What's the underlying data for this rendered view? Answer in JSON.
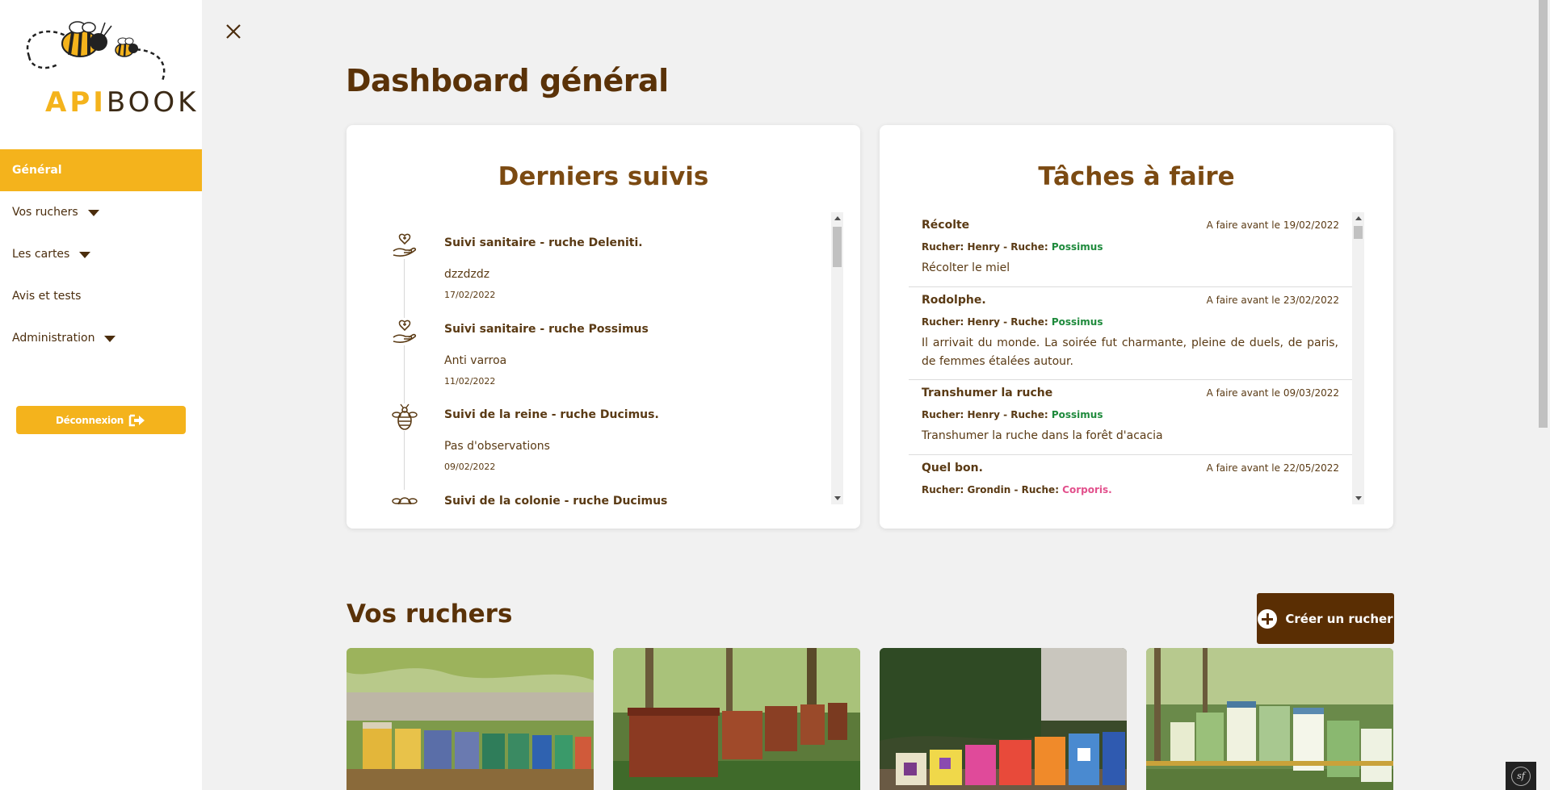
{
  "brand": {
    "api": "API",
    "book": "BOOK"
  },
  "sidebar": {
    "items": [
      {
        "label": "Général",
        "active": true,
        "has_caret": false
      },
      {
        "label": "Vos ruchers",
        "active": false,
        "has_caret": true
      },
      {
        "label": "Les cartes",
        "active": false,
        "has_caret": true
      },
      {
        "label": "Avis et tests",
        "active": false,
        "has_caret": false
      },
      {
        "label": "Administration",
        "active": false,
        "has_caret": true
      }
    ],
    "logout_label": "Déconnexion"
  },
  "page_title": "Dashboard général",
  "suivis": {
    "title": "Derniers suivis",
    "items": [
      {
        "title": "Suivi sanitaire - ruche Deleniti.",
        "desc": "dzzdzdz",
        "date": "17/02/2022",
        "icon": "heart-hand-icon"
      },
      {
        "title": "Suivi sanitaire - ruche Possimus",
        "desc": "Anti varroa",
        "date": "11/02/2022",
        "icon": "heart-hand-icon"
      },
      {
        "title": "Suivi de la reine - ruche Ducimus.",
        "desc": "Pas d'observations",
        "date": "09/02/2022",
        "icon": "bee-icon"
      },
      {
        "title": "Suivi de la colonie - ruche Ducimus",
        "desc": "",
        "date": "",
        "icon": "bee-icon"
      }
    ]
  },
  "taches": {
    "title": "Tâches à faire",
    "items": [
      {
        "title": "Récolte",
        "due": "A faire avant le 19/02/2022",
        "meta": "Rucher: Henry - Ruche: ",
        "hive": "Possimus",
        "hive_color": "green",
        "body": "Récolter le miel"
      },
      {
        "title": "Rodolphe.",
        "due": "A faire avant le 23/02/2022",
        "meta": "Rucher: Henry - Ruche: ",
        "hive": "Possimus",
        "hive_color": "green",
        "body": "Il arrivait du monde. La soirée fut charmante, pleine de duels, de paris, de femmes étalées autour."
      },
      {
        "title": "Transhumer la ruche",
        "due": "A faire avant le 09/03/2022",
        "meta": "Rucher: Henry - Ruche: ",
        "hive": "Possimus",
        "hive_color": "green",
        "body": "Transhumer la ruche dans la forêt d'acacia"
      },
      {
        "title": "Quel bon.",
        "due": "A faire avant le 22/05/2022",
        "meta": "Rucher: Grondin - Ruche: ",
        "hive": "Corporis.",
        "hive_color": "pink",
        "body": ""
      }
    ]
  },
  "ruchers": {
    "title": "Vos ruchers",
    "create_label": "Créer un rucher"
  },
  "colors": {
    "accent": "#f4b31c",
    "brown": "#5a2e03",
    "hive_green": "#1e8a3c",
    "hive_pink": "#e2508c"
  }
}
